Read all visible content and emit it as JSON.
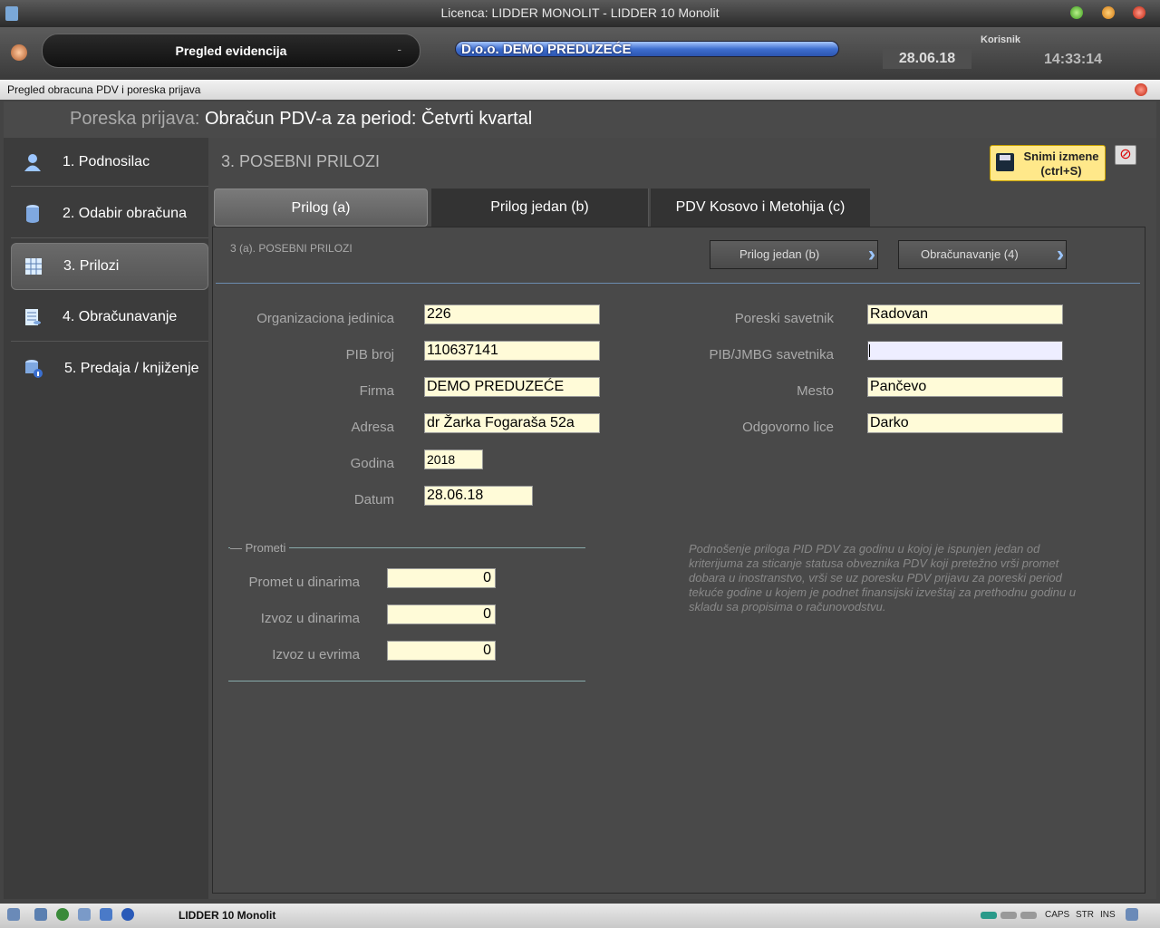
{
  "window": {
    "title": "Licenca: LIDDER MONOLIT - LIDDER 10 Monolit"
  },
  "topbar": {
    "module": "Pregled evidencija",
    "company": "D.o.o. DEMO PREDUZEĆE",
    "date": "28.06.18",
    "user_label": "Korisnik",
    "time": "14:33:14"
  },
  "subwindow": {
    "title": "Pregled obracuna PDV i poreska prijava",
    "header_prefix": "Poreska prijava:",
    "header_main": "Obračun PDV-a za period: Četvrti kvartal"
  },
  "sidebar": {
    "items": [
      {
        "label": "1. Podnosilac",
        "icon": "user-icon"
      },
      {
        "label": "2. Odabir obračuna",
        "icon": "database-icon"
      },
      {
        "label": "3. Prilozi",
        "icon": "grid-icon"
      },
      {
        "label": "4. Obračunavanje",
        "icon": "calculator-icon"
      },
      {
        "label": "5. Predaja / knjiženje",
        "icon": "database-info-icon"
      }
    ]
  },
  "main": {
    "section_title": "3. POSEBNI PRILOZI",
    "save_button": {
      "line1": "Snimi izmene",
      "line2": "(ctrl+S)"
    },
    "tabs": [
      "Prilog (a)",
      "Prilog jedan (b)",
      "PDV Kosovo i Metohija (c)"
    ],
    "panel_subtitle": "3 (a). POSEBNI PRILOZI",
    "nav_buttons": [
      "Prilog jedan (b)",
      "Obračunavanje (4)"
    ],
    "left_fields": [
      {
        "label": "Organizaciona jedinica",
        "value": "226"
      },
      {
        "label": "PIB broj",
        "value": "110637141"
      },
      {
        "label": "Firma",
        "value": "DEMO PREDUZEĆE"
      },
      {
        "label": "Adresa",
        "value": "dr Žarka Fogaraša 52a"
      },
      {
        "label": "Godina",
        "value": "2018"
      },
      {
        "label": "Datum",
        "value": "28.06.18"
      }
    ],
    "right_fields": [
      {
        "label": "Poreski savetnik",
        "value": "Radovan"
      },
      {
        "label": "PIB/JMBG savetnika",
        "value": ""
      },
      {
        "label": "Mesto",
        "value": "Pančevo"
      },
      {
        "label": "Odgovorno lice",
        "value": "Darko"
      }
    ],
    "prometi": {
      "group_label": "Prometi",
      "fields": [
        {
          "label": "Promet u dinarima",
          "value": "0"
        },
        {
          "label": "Izvoz u dinarima",
          "value": "0"
        },
        {
          "label": "Izvoz u evrima",
          "value": "0"
        }
      ]
    },
    "note": "Podnošenje priloga PID PDV za godinu u kojoj je ispunjen jedan od kriterijuma za sticanje statusa obveznika PDV koji pretežno vrši promet dobara u inostranstvo, vrši se uz poresku PDV prijavu za poreski period tekuće godine u kojem je podnet finansijski izveštaj za prethodnu godinu u skladu sa propisima o računovodstvu."
  },
  "statusbar": {
    "app": "LIDDER 10 Monolit",
    "keys": [
      "CAPS",
      "STR",
      "INS"
    ]
  }
}
